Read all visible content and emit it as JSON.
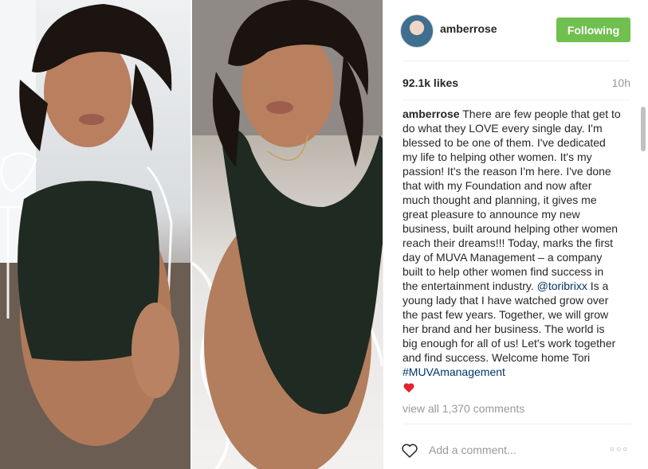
{
  "post": {
    "username": "amberrose",
    "follow_label": "Following",
    "likes": "92.1k likes",
    "time_ago": "10h",
    "caption": {
      "user": "amberrose",
      "text_1": " There are few people that get to do what they LOVE every single day. I'm blessed to be one of them. I've dedicated my life to helping other women. It's my passion! It's the reason I'm here. I've done that with my Foundation and now after much thought and planning, it gives me great pleasure to announce my new business, built around helping other women reach their dreams!!! Today, marks the first day of MUVA Management – a company built to help other women find success in the entertainment industry. ",
      "mention": "@toribrixx",
      "text_2": " Is a young lady that I have watched grow over the past few years. Together, we will grow her brand and her business. The world is big enough for all of us! Let's work together and find success. Welcome home Tori ",
      "hashtag": "#MUVAmanagement"
    },
    "view_comments": "view all 1,370 comments",
    "comment_placeholder": "Add a comment...",
    "more_icon": "○○○"
  },
  "colors": {
    "follow_green": "#70c050",
    "link_blue": "#003569",
    "muted_gray": "#999999",
    "heart_red": "#e0232e"
  },
  "icons": [
    "avatar",
    "heart-emoji-icon",
    "like-heart-icon",
    "more-options-icon"
  ]
}
